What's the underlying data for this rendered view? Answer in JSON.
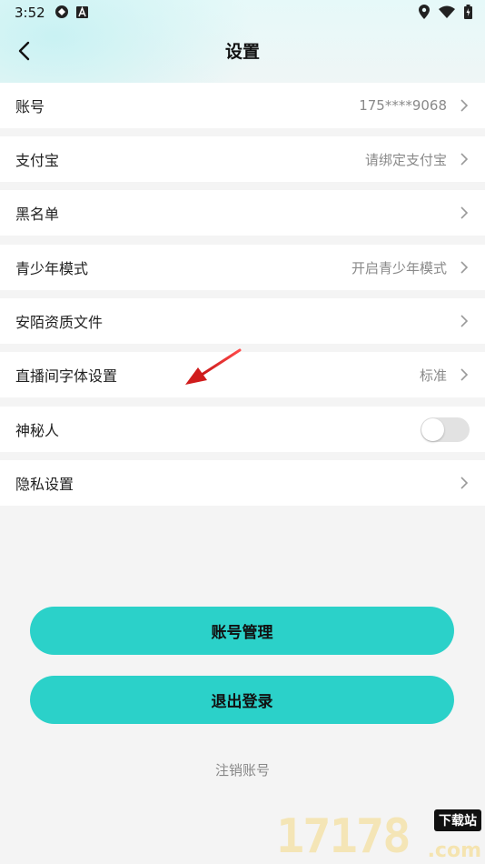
{
  "status_bar": {
    "time": "3:52",
    "left_icons": [
      "sync-icon",
      "a-badge-icon"
    ],
    "right_icons": [
      "location-icon",
      "wifi-icon",
      "battery-icon"
    ]
  },
  "header": {
    "title": "设置",
    "back_icon": "back-chevron-icon"
  },
  "settings": [
    {
      "label": "账号",
      "value": "175****9068"
    },
    {
      "label": "支付宝",
      "value": "请绑定支付宝"
    },
    {
      "label": "黑名单",
      "value": ""
    },
    {
      "label": "青少年模式",
      "value": "开启青少年模式"
    },
    {
      "label": "安陌资质文件",
      "value": ""
    },
    {
      "label": "直播间字体设置",
      "value": "标准"
    },
    {
      "label": "神秘人",
      "toggle": false
    },
    {
      "label": "隐私设置",
      "value": ""
    }
  ],
  "buttons": {
    "account_manage": "账号管理",
    "logout": "退出登录"
  },
  "links": {
    "cancel_account": "注销账号"
  },
  "watermark": {
    "number": "17178",
    "tag": "下载站",
    "suffix": ".com"
  },
  "colors": {
    "accent": "#2bd1c9",
    "annotation_arrow": "#e02020"
  }
}
